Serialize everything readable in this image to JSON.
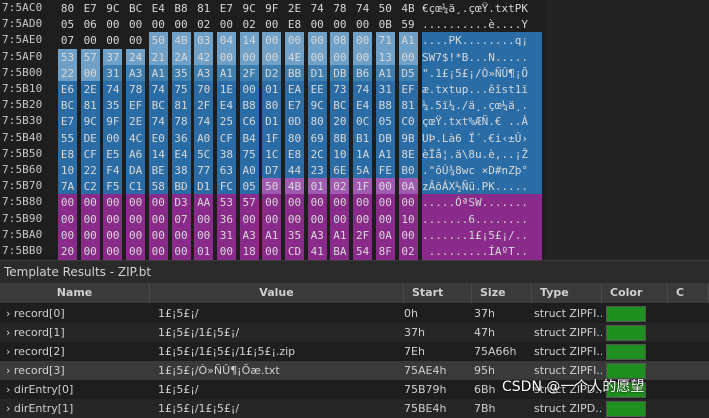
{
  "hex_rows": [
    {
      "addr": "7:5AC0",
      "bytes": [
        "80",
        "E7",
        "9C",
        "BC",
        "E4",
        "B8",
        "81",
        "E7",
        "9C",
        "9F",
        "2E",
        "74",
        "78",
        "74",
        "50",
        "4B"
      ],
      "ascii": "€çœ¼ä¸.çœŸ.txtPK"
    },
    {
      "addr": "7:5AD0",
      "bytes": [
        "05",
        "06",
        "00",
        "00",
        "00",
        "00",
        "02",
        "00",
        "02",
        "00",
        "E8",
        "00",
        "00",
        "00",
        "0B",
        "59"
      ],
      "ascii": "..........è....Y"
    },
    {
      "addr": "7:5AE0",
      "bytes": [
        "07",
        "00",
        "00",
        "00",
        "50",
        "4B",
        "03",
        "04",
        "14",
        "00",
        "00",
        "00",
        "08",
        "00",
        "71",
        "A1"
      ],
      "ascii": "....PK........q¡"
    },
    {
      "addr": "7:5AF0",
      "bytes": [
        "53",
        "57",
        "37",
        "24",
        "21",
        "2A",
        "42",
        "00",
        "00",
        "00",
        "4E",
        "00",
        "00",
        "00",
        "13",
        "00"
      ],
      "ascii": "SW7$!*B...N....."
    },
    {
      "addr": "7:5B00",
      "bytes": [
        "22",
        "00",
        "31",
        "A3",
        "A1",
        "35",
        "A3",
        "A1",
        "2F",
        "D2",
        "BB",
        "D1",
        "DB",
        "B6",
        "A1",
        "D5"
      ],
      "ascii": "\".1£¡5£¡/Ò»ÑÛ¶¡Õ"
    },
    {
      "addr": "7:5B10",
      "bytes": [
        "E6",
        "2E",
        "74",
        "78",
        "74",
        "75",
        "70",
        "1E",
        "00",
        "01",
        "EA",
        "EE",
        "73",
        "74",
        "31",
        "EF"
      ],
      "ascii": "æ.txtup...êîst1ï"
    },
    {
      "addr": "7:5B20",
      "bytes": [
        "BC",
        "81",
        "35",
        "EF",
        "BC",
        "81",
        "2F",
        "E4",
        "B8",
        "80",
        "E7",
        "9C",
        "BC",
        "E4",
        "B8",
        "81"
      ],
      "ascii": "¼.5ï¼./ä¸.çœ¼ä¸."
    },
    {
      "addr": "7:5B30",
      "bytes": [
        "E7",
        "9C",
        "9F",
        "2E",
        "74",
        "78",
        "74",
        "25",
        "C6",
        "D1",
        "0D",
        "80",
        "20",
        "0C",
        "05",
        "C0"
      ],
      "ascii": "çœŸ.txt%ÆÑ.€ ..À"
    },
    {
      "addr": "7:5B40",
      "bytes": [
        "55",
        "DE",
        "00",
        "4C",
        "E0",
        "36",
        "A0",
        "CF",
        "B4",
        "1F",
        "80",
        "69",
        "8B",
        "B1",
        "DB",
        "9B"
      ],
      "ascii": "UÞ.Là6 Ï´.€i‹±Û›"
    },
    {
      "addr": "7:5B50",
      "bytes": [
        "E8",
        "CF",
        "E5",
        "A6",
        "14",
        "E4",
        "5C",
        "38",
        "75",
        "1C",
        "E8",
        "2C",
        "10",
        "1A",
        "A1",
        "8E"
      ],
      "ascii": "èÏå¦.ä\\8u.è,..¡Ž"
    },
    {
      "addr": "7:5B60",
      "bytes": [
        "10",
        "22",
        "F4",
        "DA",
        "BE",
        "38",
        "77",
        "63",
        "A0",
        "D7",
        "44",
        "23",
        "6E",
        "5A",
        "FE",
        "B0"
      ],
      "ascii": ".\"ôÚ¾8wc ×D#nZþ°"
    },
    {
      "addr": "7:5B70",
      "bytes": [
        "7A",
        "C2",
        "F5",
        "C1",
        "58",
        "BD",
        "D1",
        "FC",
        "05",
        "50",
        "4B",
        "01",
        "02",
        "1F",
        "00",
        "0A"
      ],
      "ascii": "zÂõÁX½Ñü.PK....."
    },
    {
      "addr": "7:5B80",
      "bytes": [
        "00",
        "00",
        "00",
        "00",
        "00",
        "D3",
        "AA",
        "53",
        "57",
        "00",
        "00",
        "00",
        "00",
        "00",
        "00",
        "00"
      ],
      "ascii": ".....ÓªSW......."
    },
    {
      "addr": "7:5B90",
      "bytes": [
        "00",
        "00",
        "00",
        "00",
        "00",
        "07",
        "00",
        "36",
        "00",
        "00",
        "00",
        "00",
        "00",
        "00",
        "00",
        "10"
      ],
      "ascii": ".......6........"
    },
    {
      "addr": "7:5BA0",
      "bytes": [
        "00",
        "00",
        "00",
        "00",
        "00",
        "00",
        "00",
        "31",
        "A3",
        "A1",
        "35",
        "A3",
        "A1",
        "2F",
        "0A",
        "00"
      ],
      "ascii": ".......1£¡5£¡/.."
    },
    {
      "addr": "7:5BB0",
      "bytes": [
        "20",
        "00",
        "00",
        "00",
        "00",
        "00",
        "01",
        "00",
        "18",
        "00",
        "CD",
        "41",
        "BA",
        "54",
        "8F",
        "02"
      ],
      "ascii": " .........ÍAºT.."
    }
  ],
  "template": {
    "title": "Template Results - ZIP.bt",
    "refresh_icon": "refresh-icon",
    "columns": [
      "Name",
      "Value",
      "Start",
      "Size",
      "Type",
      "Color",
      "C"
    ],
    "rows": [
      {
        "name": "record[0]",
        "value": "1£¡5£¡/",
        "start": "0h",
        "size": "37h",
        "type": "struct ZIPFI..."
      },
      {
        "name": "record[1]",
        "value": "1£¡5£¡/1£¡5£¡/",
        "start": "37h",
        "size": "47h",
        "type": "struct ZIPFI..."
      },
      {
        "name": "record[2]",
        "value": "1£¡5£¡/1£¡5£¡/1£¡5£¡.zip",
        "start": "7Eh",
        "size": "75A66h",
        "type": "struct ZIPFI..."
      },
      {
        "name": "record[3]",
        "value": "1£¡5£¡/Ò»ÑÛ¶¡Õæ.txt",
        "start": "75AE4h",
        "size": "95h",
        "type": "struct ZIPFI..."
      },
      {
        "name": "dirEntry[0]",
        "value": "1£¡5£¡/",
        "start": "75B79h",
        "size": "6Bh",
        "type": "struct ZIPD..."
      },
      {
        "name": "dirEntry[1]",
        "value": "1£¡5£¡/1£¡5£¡/",
        "start": "75BE4h",
        "size": "7Bh",
        "type": "struct ZIPD..."
      }
    ]
  },
  "watermark": "CSDN @一个人的愿望",
  "colors": {
    "green": "#1f8f1f",
    "blue": "#2a6da6",
    "purple": "#8a2a8a"
  }
}
